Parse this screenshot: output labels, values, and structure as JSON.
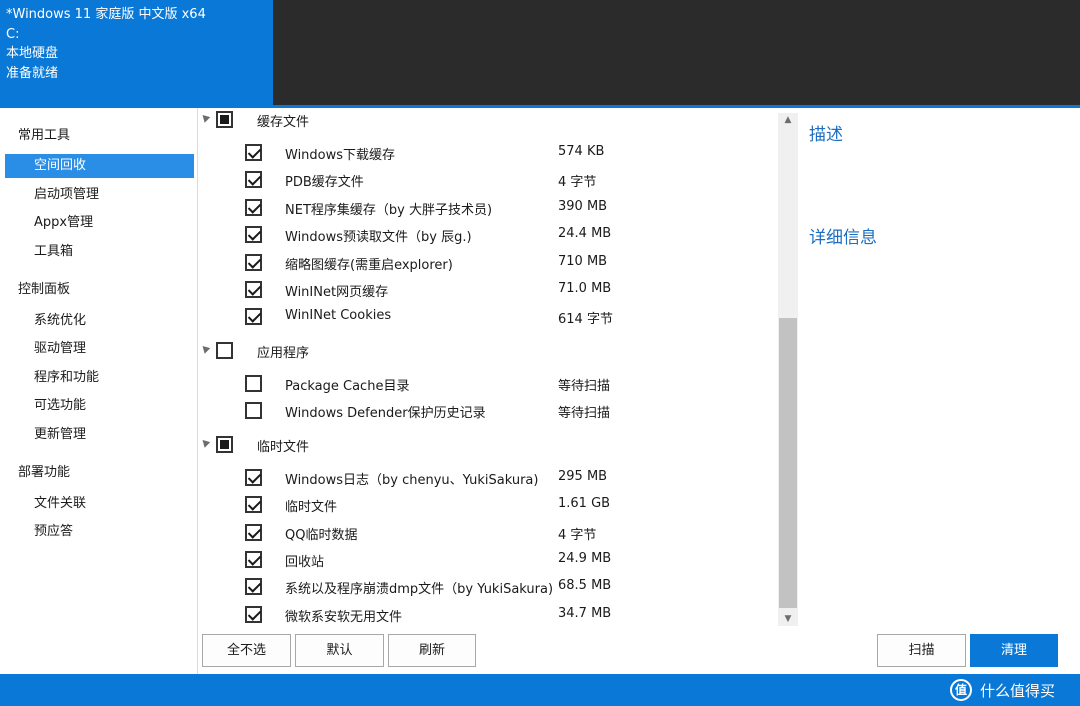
{
  "header": {
    "lines": [
      "*Windows 11 家庭版 中文版 x64",
      "C:",
      "本地硬盘",
      "准备就绪"
    ]
  },
  "sidebar": {
    "groups": [
      {
        "title": "常用工具",
        "items": [
          "空间回收",
          "启动项管理",
          "Appx管理",
          "工具箱"
        ]
      },
      {
        "title": "控制面板",
        "items": [
          "系统优化",
          "驱动管理",
          "程序和功能",
          "可选功能",
          "更新管理"
        ]
      },
      {
        "title": "部署功能",
        "items": [
          "文件关联",
          "预应答"
        ]
      }
    ],
    "selected": "空间回收"
  },
  "tree": {
    "categories": [
      {
        "label": "缓存文件",
        "state": "partial",
        "items": [
          {
            "name": "Windows下载缓存",
            "size": "574 KB",
            "checked": true
          },
          {
            "name": "PDB缓存文件",
            "size": "4 字节",
            "checked": true
          },
          {
            "name": "NET程序集缓存（by 大胖子技术员)",
            "size": "390 MB",
            "checked": true
          },
          {
            "name": "Windows预读取文件（by 辰g.)",
            "size": "24.4 MB",
            "checked": true
          },
          {
            "name": "缩略图缓存(需重启explorer)",
            "size": "710 MB",
            "checked": true
          },
          {
            "name": "WinINet网页缓存",
            "size": "71.0 MB",
            "checked": true
          },
          {
            "name": "WinINet Cookies",
            "size": "614 字节",
            "checked": true
          }
        ]
      },
      {
        "label": "应用程序",
        "state": "unchecked",
        "items": [
          {
            "name": "Package Cache目录",
            "size": "等待扫描",
            "checked": false
          },
          {
            "name": "Windows Defender保护历史记录",
            "size": "等待扫描",
            "checked": false
          }
        ]
      },
      {
        "label": "临时文件",
        "state": "partial",
        "items": [
          {
            "name": "Windows日志（by chenyu、YukiSakura)",
            "size": "295 MB",
            "checked": true
          },
          {
            "name": "临时文件",
            "size": "1.61 GB",
            "checked": true
          },
          {
            "name": "QQ临时数据",
            "size": "4 字节",
            "checked": true
          },
          {
            "name": "回收站",
            "size": "24.9 MB",
            "checked": true
          },
          {
            "name": "系统以及程序崩溃dmp文件（by YukiSakura)",
            "size": "68.5 MB",
            "checked": true
          },
          {
            "name": "微软系安软无用文件",
            "size": "34.7 MB",
            "checked": true
          }
        ]
      }
    ]
  },
  "right_panel": {
    "description_title": "描述",
    "details_title": "详细信息"
  },
  "buttons": {
    "select_none": "全不选",
    "default": "默认",
    "refresh": "刷新",
    "scan": "扫描",
    "clean": "清理"
  },
  "watermark": {
    "logo": "值",
    "text": "什么值得买"
  },
  "colors": {
    "accent": "#0a78d7",
    "selected": "#2a8ee6",
    "header_dark": "#2b2b2b",
    "panel_title": "#1b6ec2"
  }
}
